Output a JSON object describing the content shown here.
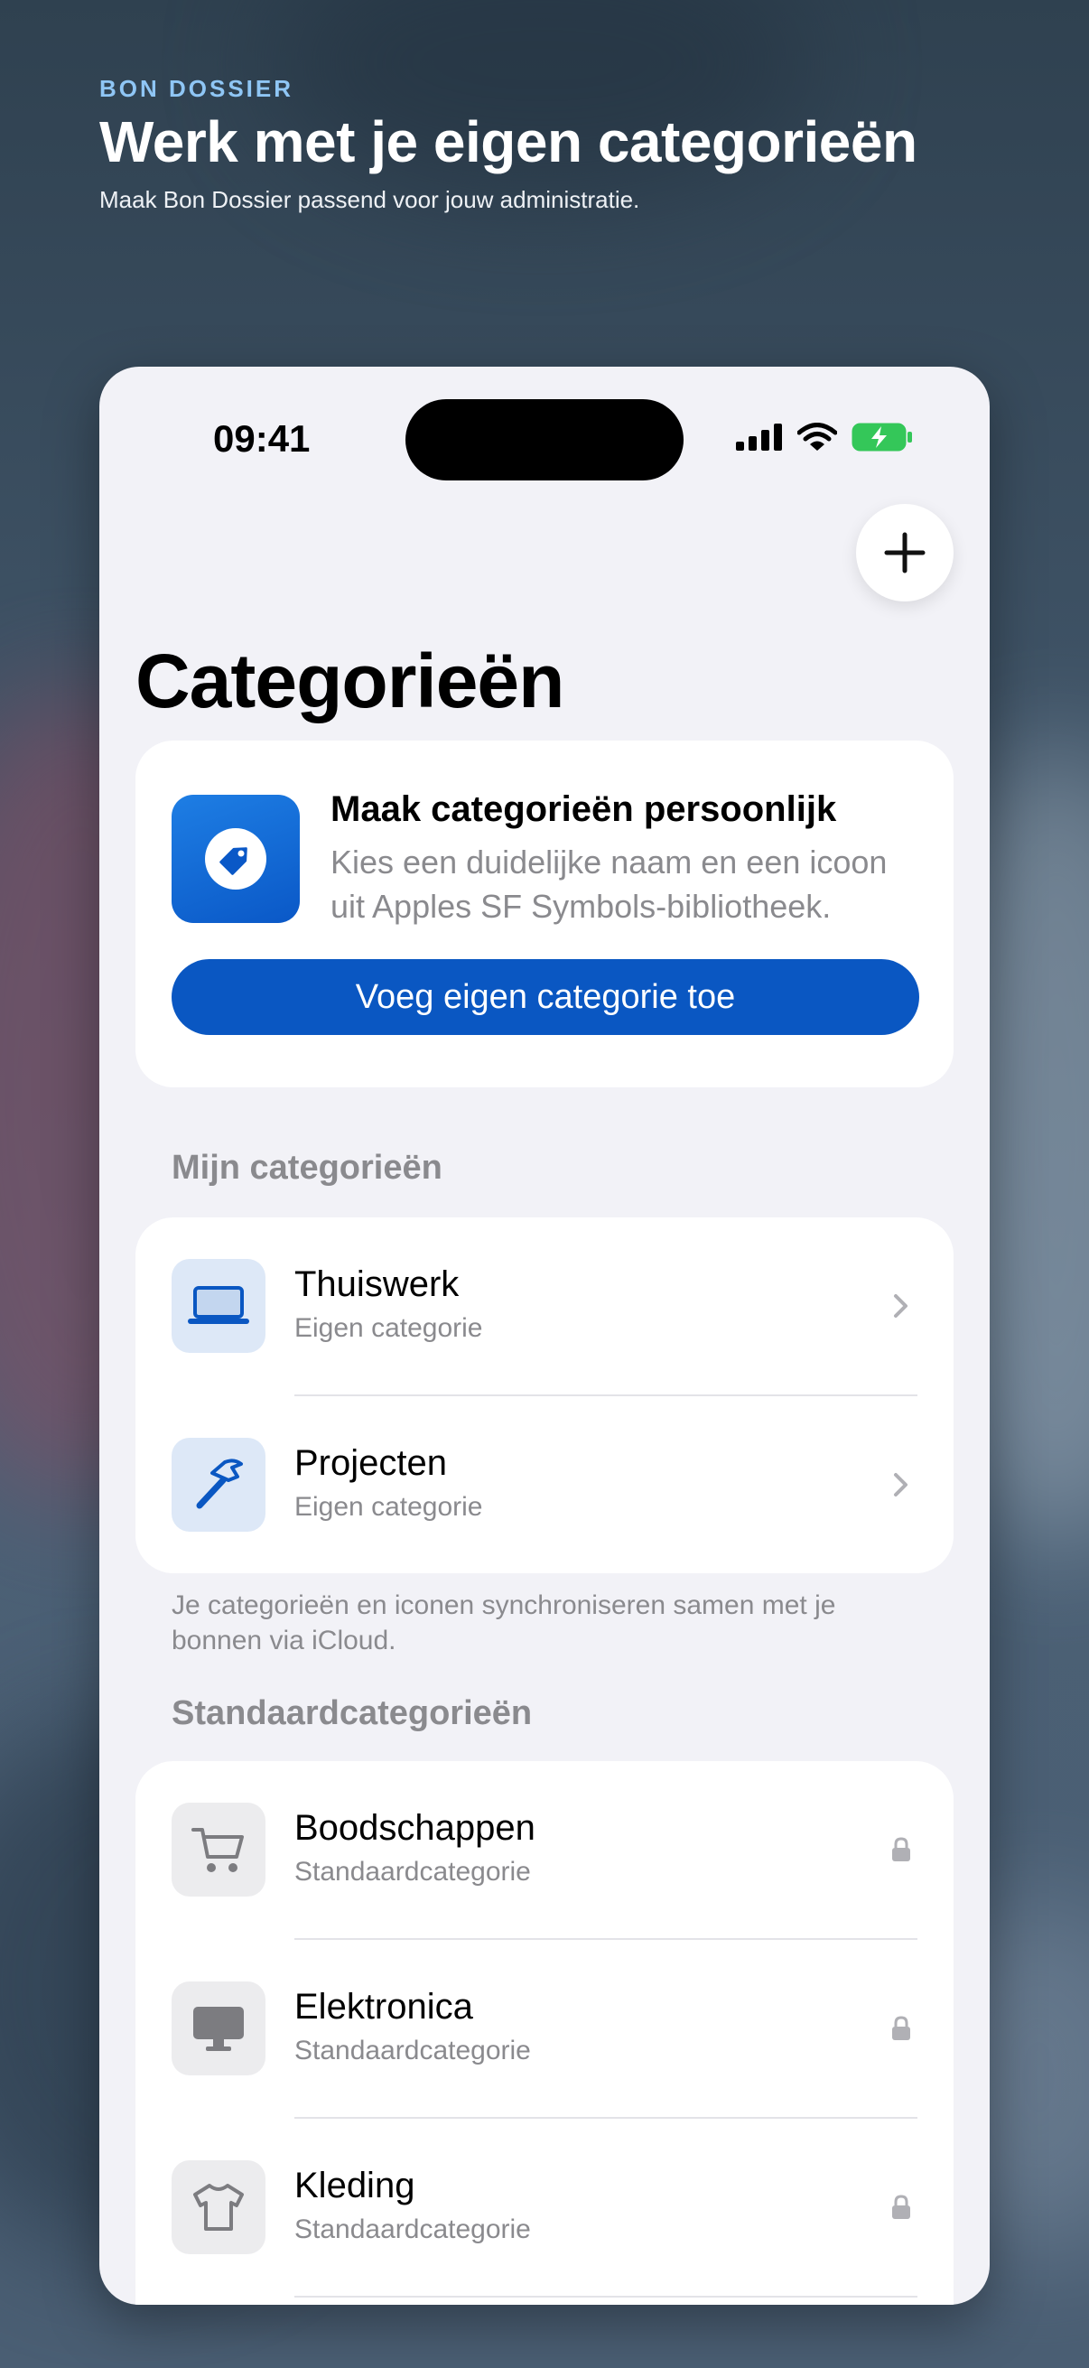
{
  "promo": {
    "eyebrow": "BON DOSSIER",
    "headline": "Werk met je eigen categorieën",
    "subline": "Maak Bon Dossier passend voor jouw administratie."
  },
  "status_bar": {
    "time": "09:41"
  },
  "page": {
    "title": "Categorieën"
  },
  "hero": {
    "title": "Maak categorieën persoonlijk",
    "description": "Kies een duidelijke naam en een icoon uit Apples SF Symbols-bibliotheek.",
    "button": "Voeg eigen categorie toe",
    "icon": "tag-icon"
  },
  "my_categories": {
    "header": "Mijn categorieën",
    "items": [
      {
        "title": "Thuiswerk",
        "subtitle": "Eigen categorie",
        "icon": "laptop-icon"
      },
      {
        "title": "Projecten",
        "subtitle": "Eigen categorie",
        "icon": "hammer-icon"
      }
    ],
    "footnote": "Je categorieën en iconen synchroniseren samen met je bonnen via iCloud."
  },
  "standard_categories": {
    "header": "Standaardcategorieën",
    "items": [
      {
        "title": "Boodschappen",
        "subtitle": "Standaardcategorie",
        "icon": "cart-icon"
      },
      {
        "title": "Elektronica",
        "subtitle": "Standaardcategorie",
        "icon": "desktop-icon"
      },
      {
        "title": "Kleding",
        "subtitle": "Standaardcategorie",
        "icon": "tshirt-icon"
      }
    ]
  },
  "colors": {
    "accent": "#0a57c2",
    "background": "#f2f2f7",
    "battery": "#34c759"
  }
}
